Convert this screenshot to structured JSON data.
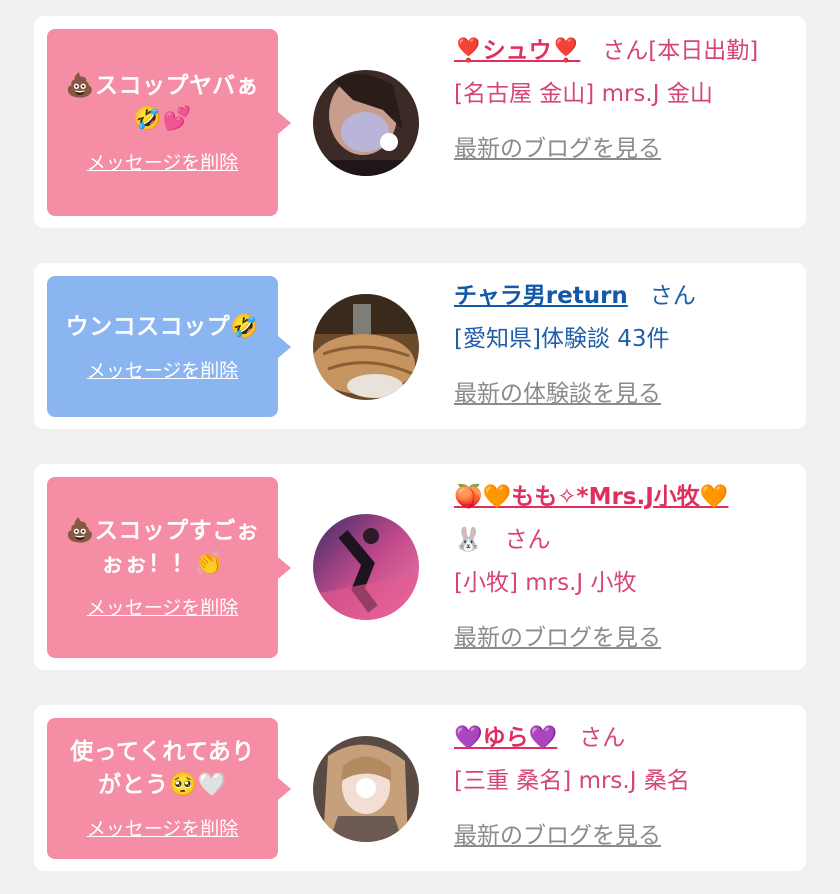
{
  "messages": [
    {
      "bubble_text": "💩スコップヤバぁ\n🤣💕",
      "delete_label": "メッセージを削除",
      "name": "❣️シュウ❣️",
      "san": "さん",
      "status": "[本日出勤]",
      "location": "[名古屋 金山] mrs.J 金山",
      "latest_label": "最新のブログを見る"
    },
    {
      "bubble_text": "ウンコスコップ🤣",
      "delete_label": "メッセージを削除",
      "name": "チャラ男return",
      "san": "さん",
      "location": "[愛知県]体験談 43件",
      "latest_label": "最新の体験談を見る"
    },
    {
      "bubble_text": "💩スコップすごぉ\nぉぉ！！👏",
      "delete_label": "メッセージを削除",
      "name": "🍑🧡もも✧*Mrs.J小牧🧡",
      "name_suffix": "🐰",
      "san": "さん",
      "location": "[小牧] mrs.J 小牧",
      "latest_label": "最新のブログを見る"
    },
    {
      "bubble_text": "使ってくれてあり\nがとう🥺🤍",
      "delete_label": "メッセージを削除",
      "name": "💜ゆら💜",
      "san": "さん",
      "location": "[三重 桑名] mrs.J 桑名",
      "latest_label": "最新のブログを見る"
    }
  ],
  "colors": {
    "pink_bubble": "#f58da4",
    "blue_bubble": "#8ab5f1",
    "pink_text": "#d54672",
    "blue_text": "#1f5ea8",
    "link_gray": "#8b8b8b"
  }
}
